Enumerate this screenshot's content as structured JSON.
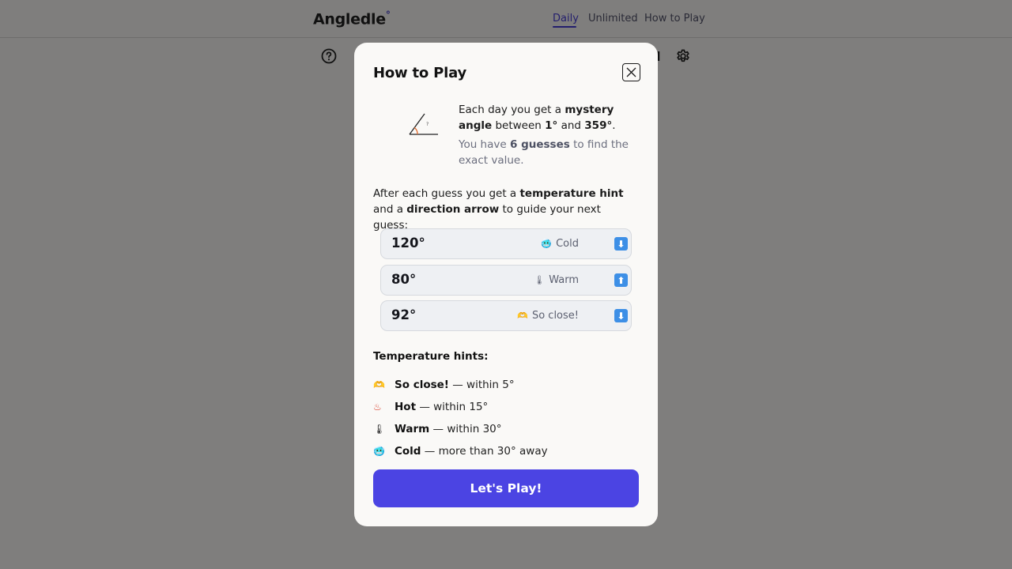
{
  "app": {
    "logo": "Angledle",
    "logo_mark": "°"
  },
  "nav": {
    "daily": "Daily",
    "unlimited": "Unlimited",
    "how_to_play": "How to Play"
  },
  "modal": {
    "title": "How to Play",
    "intro_1_pre": "Each day you get a ",
    "intro_1_bold": "mystery angle",
    "intro_1_mid": " between ",
    "intro_1_min": "1°",
    "intro_1_and": " and ",
    "intro_1_max": "359°",
    "intro_1_end": ".",
    "intro_2_pre": "You have ",
    "intro_2_bold": "6 guesses",
    "intro_2_end": " to find the exact value.",
    "after_pre": "After each guess you get a ",
    "after_bold1": "temperature hint",
    "after_mid": " and a ",
    "after_bold2": "direction arrow",
    "after_end": " to guide your next guess:",
    "examples": [
      {
        "value": "120°",
        "hint": "Cold",
        "hint_icon": "🥶",
        "arrow": "⬇"
      },
      {
        "value": "80°",
        "hint": "Warm",
        "hint_icon": "🌡",
        "arrow": "⬆"
      },
      {
        "value": "92°",
        "hint": "So close!",
        "hint_icon": "🫶",
        "arrow": "⬇"
      }
    ],
    "hints_title": "Temperature hints:",
    "hints": [
      {
        "icon": "🫶",
        "label": "So close!",
        "desc": " — within 5°"
      },
      {
        "icon": "♨",
        "label": "Hot",
        "desc": " — within 15°"
      },
      {
        "icon": "🌡",
        "label": "Warm",
        "desc": " — within 30°"
      },
      {
        "icon": "🥶",
        "label": "Cold",
        "desc": " — more than 30° away"
      }
    ],
    "cta": "Let's Play!"
  },
  "colors": {
    "accent": "#4b44e3",
    "arrow": "#3d8fe6",
    "overlay": "#7f7e7d"
  },
  "icons": {
    "help": "help-circle-icon",
    "settings": "gear-icon",
    "close": "close-icon",
    "angle": "angle-illustration-icon"
  }
}
